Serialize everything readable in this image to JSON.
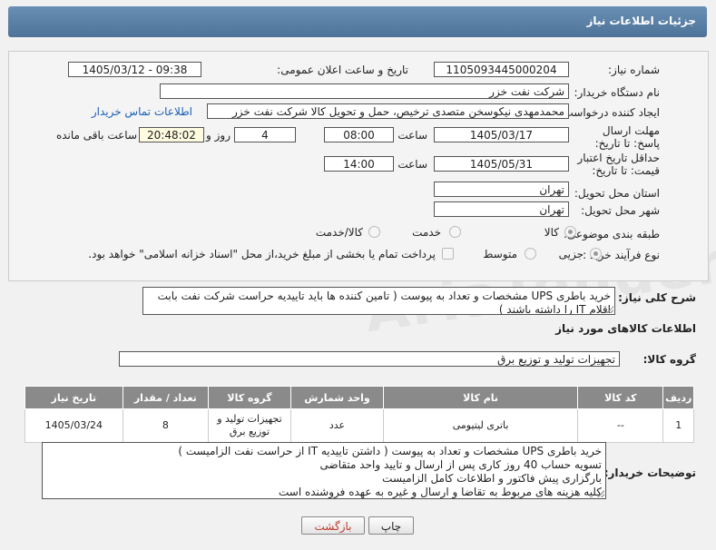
{
  "header": {
    "title": "جزئیات اطلاعات نیاز"
  },
  "labels": {
    "need_number": "شماره نیاز:",
    "announce_datetime": "تاریخ و ساعت اعلان عمومی:",
    "buyer_org": "نام دستگاه خریدار:",
    "requester": "ایجاد کننده درخواست:",
    "contact_link": "اطلاعات تماس خریدار",
    "reply_deadline": "مهلت ارسال پاسخ: تا تاریخ:",
    "price_validity": "حداقل تاریخ اعتبار قیمت: تا تاریخ:",
    "time": "ساعت",
    "day_and": "روز و",
    "remaining": "ساعت باقی مانده",
    "province": "استان محل تحویل:",
    "city": "شهر محل تحویل:",
    "category": "طبقه بندی موضوعی:",
    "process_type": "نوع فرآیند خرید :",
    "general_desc": "شرح کلی نیاز:",
    "goods_info": "اطلاعات کالاهای مورد نیاز",
    "goods_group": "گروه کالا:",
    "buyer_notes": "توضیحات خریدار:"
  },
  "fields": {
    "need_number": "1105093445000204",
    "announce_datetime": "1405/03/12 - 09:38",
    "buyer_org": "شرکت نفت خزر",
    "requester": "محمدمهدی نیکوسخن متصدی ترخیص، حمل و تحویل کالا شرکت نفت خزر",
    "reply_date": "1405/03/17",
    "reply_time": "08:00",
    "reply_days": "4",
    "reply_remaining": "20:48:02",
    "validity_date": "1405/05/31",
    "validity_time": "14:00",
    "province": "تهران",
    "city": "تهران",
    "goods_group": "تجهیزات تولید و توزیع برق"
  },
  "category_options": [
    {
      "label": "کالا",
      "selected": true
    },
    {
      "label": "خدمت",
      "selected": false
    },
    {
      "label": "کالا/خدمت",
      "selected": false
    }
  ],
  "process_options": [
    {
      "label": "جزیی",
      "selected": true
    },
    {
      "label": "متوسط",
      "selected": false
    }
  ],
  "payment_note": "پرداخت تمام یا بخشی از مبلغ خرید،از محل \"اسناد خزانه اسلامی\" خواهد بود.",
  "general_description": "خرید باطری UPS مشخصات و تعداد به پیوست ( تامین کننده ها باید تاییدیه حراست شرکت نفت  بابت اقلام IT را داشته باشند )",
  "table": {
    "headers": [
      "ردیف",
      "کد کالا",
      "نام کالا",
      "واحد شمارش",
      "گروه کالا",
      "تعداد / مقدار",
      "تاریخ نیاز"
    ],
    "rows": [
      [
        "1",
        "--",
        "باتری لیتیومی",
        "عدد",
        "تجهیزات تولید و توزیع برق",
        "8",
        "1405/03/24"
      ]
    ]
  },
  "buyer_notes_lines": [
    "خرید باطری UPS مشخصات و تعداد به پیوست ( داشتن تاییدیه IT از حراست نفت الزامیست )",
    "تسویه حساب 40 روز کاری پس از ارسال و تایید واحد متقاضی",
    "بارگزاری پیش فاکتور و اطلاعات کامل الزامیست",
    "کلیه هزینه های مربوط به تقاضا و ارسال و غیره به عهده فروشنده است"
  ],
  "buttons": {
    "print": "چاپ",
    "back": "بازگشت"
  },
  "watermark": "AriaTender.net",
  "colors": {
    "header": "#5a7fa6",
    "link": "#1a5fb4",
    "back_text": "#c0392b"
  }
}
